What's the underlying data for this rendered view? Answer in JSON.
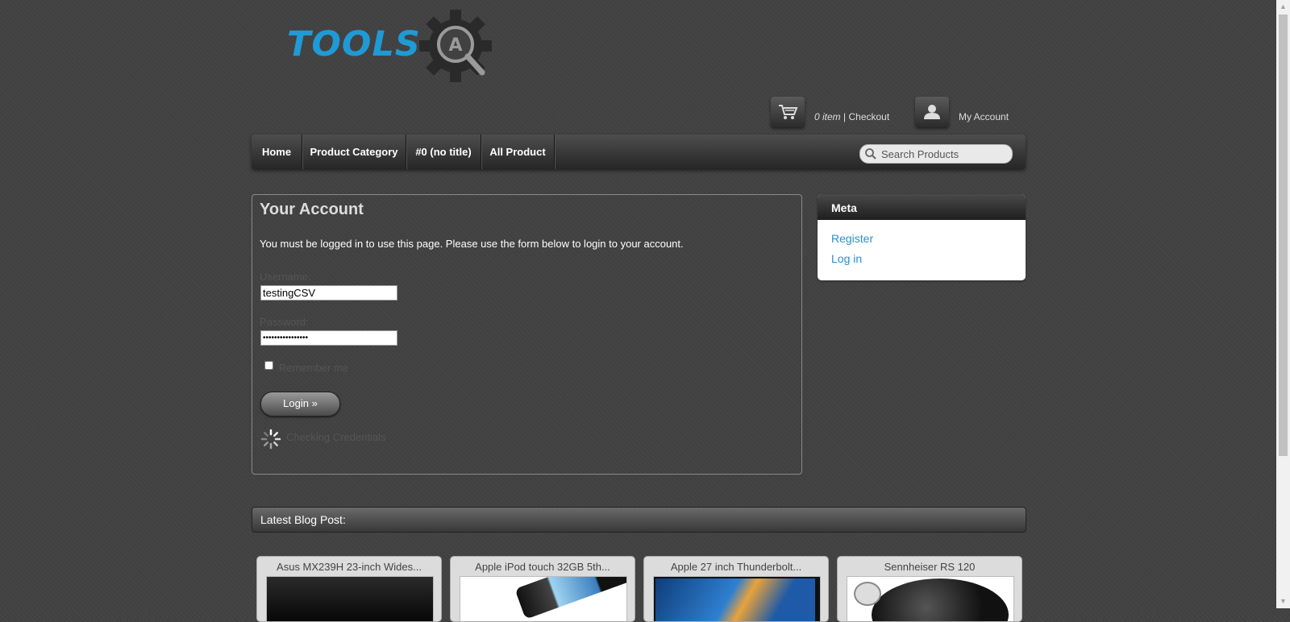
{
  "logo": {
    "text": "TOOLS",
    "badge_letter": "A"
  },
  "header": {
    "cart_count": "0 item",
    "cart_sep": " | ",
    "checkout_label": "Checkout",
    "account_label": "My Account"
  },
  "nav": {
    "items": [
      {
        "label": "Home"
      },
      {
        "label": "Product Category"
      },
      {
        "label": "#0 (no title)"
      },
      {
        "label": "All Product"
      }
    ],
    "search_placeholder": "Search Products"
  },
  "account": {
    "title": "Your Account",
    "message": "You must be logged in to use this page. Please use the form below to login to your account.",
    "username_label": "Username:",
    "username_value": "testingCSV",
    "password_label": "Password:",
    "password_value": "••••••••••••••••",
    "remember_label": "Remember me",
    "login_button": "Login »",
    "status": "Checking Credentials"
  },
  "meta": {
    "title": "Meta",
    "links": [
      {
        "label": "Register"
      },
      {
        "label": "Log in"
      }
    ]
  },
  "latest": {
    "title": "Latest Blog Post:",
    "cards": [
      {
        "title": "Asus MX239H 23-inch Wides..."
      },
      {
        "title": "Apple iPod touch 32GB 5th..."
      },
      {
        "title": "Apple 27 inch Thunderbolt..."
      },
      {
        "title": "Sennheiser RS 120"
      }
    ]
  },
  "colors": {
    "brand": "#1f9ad6",
    "link": "#2a8fd1",
    "background": "#414141"
  }
}
